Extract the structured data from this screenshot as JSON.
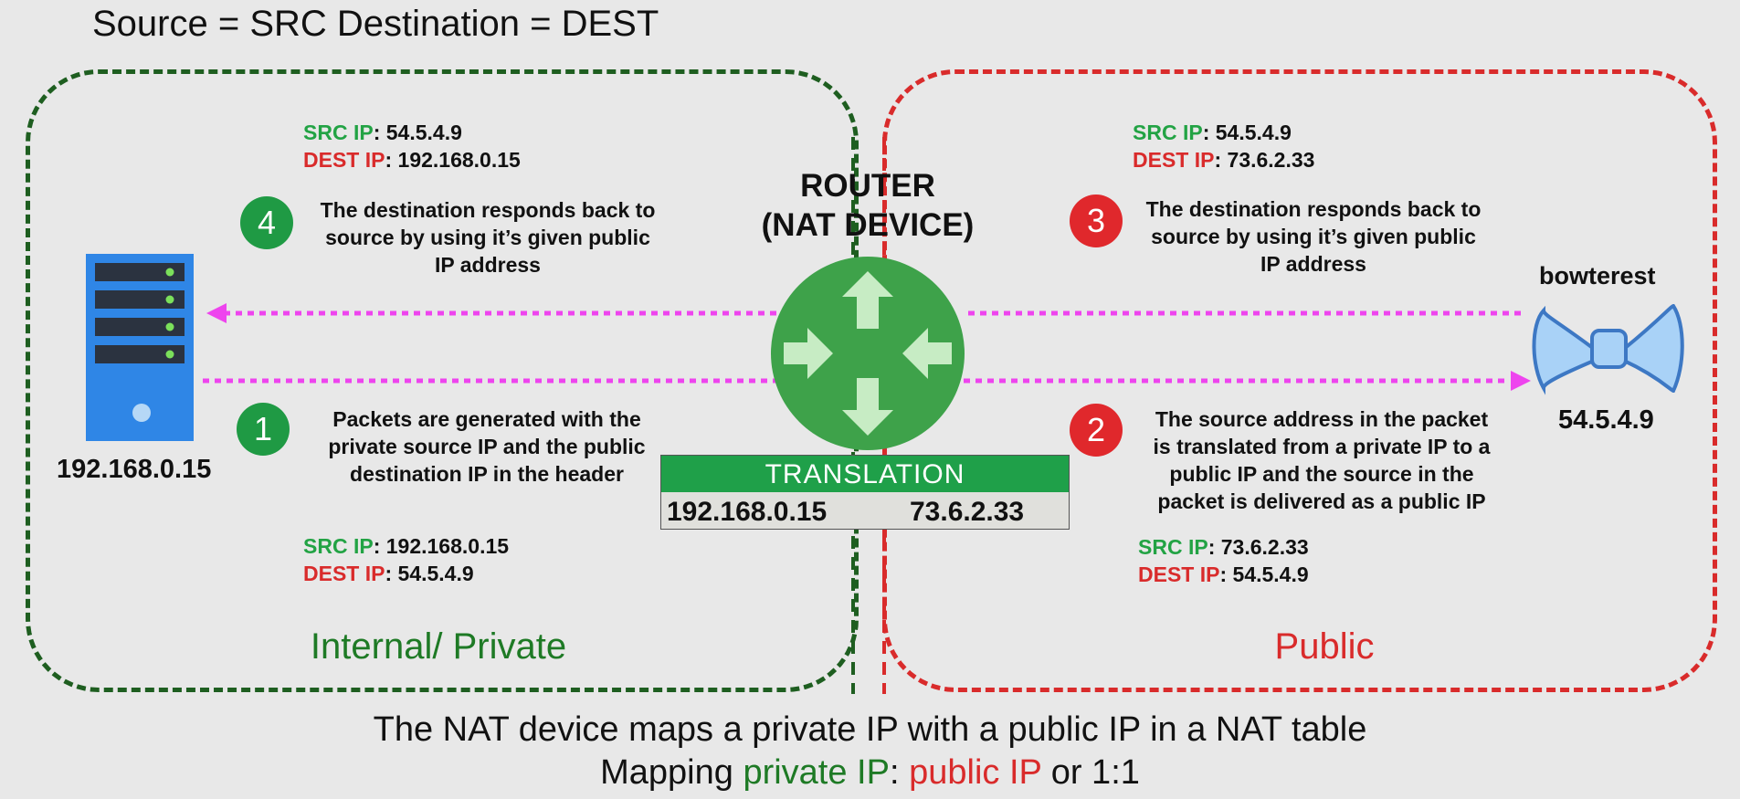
{
  "legend": "Source = SRC  Destination = DEST",
  "zones": {
    "private_label": "Internal/ Private",
    "public_label": "Public"
  },
  "router": {
    "line1": "ROUTER",
    "line2": "(NAT DEVICE)"
  },
  "translation": {
    "title": "TRANSLATION",
    "private_ip": "192.168.0.15",
    "public_ip": "73.6.2.33"
  },
  "nodes": {
    "server_ip": "192.168.0.15",
    "website_name": "bowterest",
    "website_ip": "54.5.4.9"
  },
  "headers": {
    "src_key": "SRC IP",
    "dest_key": "DEST IP",
    "sep": ": ",
    "top_left": {
      "src": "54.5.4.9",
      "dest": "192.168.0.15"
    },
    "top_right": {
      "src": "54.5.4.9",
      "dest": "73.6.2.33"
    },
    "bottom_left": {
      "src": "192.168.0.15",
      "dest": "54.5.4.9"
    },
    "bottom_right": {
      "src": "73.6.2.33",
      "dest": "54.5.4.9"
    }
  },
  "steps": {
    "step1": {
      "num": "1",
      "lines": [
        "Packets are generated with the",
        "private source IP and the public",
        "destination IP in the header"
      ]
    },
    "step2": {
      "num": "2",
      "lines": [
        "The source address in the packet",
        "is translated from a private IP to a",
        "public IP and the source in the",
        "packet is delivered as a public IP"
      ]
    },
    "step3": {
      "num": "3",
      "lines": [
        "The destination responds back to",
        "source by using it’s given public",
        "IP address"
      ]
    },
    "step4": {
      "num": "4",
      "lines": [
        "The destination responds back to",
        "source by using it’s given public",
        "IP address"
      ]
    }
  },
  "footer": {
    "line1": "The NAT device maps a private IP with a public IP in a NAT table",
    "line2_pre": "Mapping ",
    "line2_private": "private IP",
    "line2_colon": ": ",
    "line2_public": "public IP",
    "line2_post": " or 1:1"
  },
  "colors": {
    "private_green": "#1e5e20",
    "public_red": "#d92b2b",
    "src_green": "#22a344",
    "flow_magenta": "#ee44ee",
    "router_green": "#3ea24a",
    "server_blue": "#2f86e6",
    "bowtie_blue": "#a9d2f7"
  },
  "icons": {
    "server": "server-tower-icon",
    "router": "router-arrows-icon",
    "website": "bowtie-icon"
  }
}
